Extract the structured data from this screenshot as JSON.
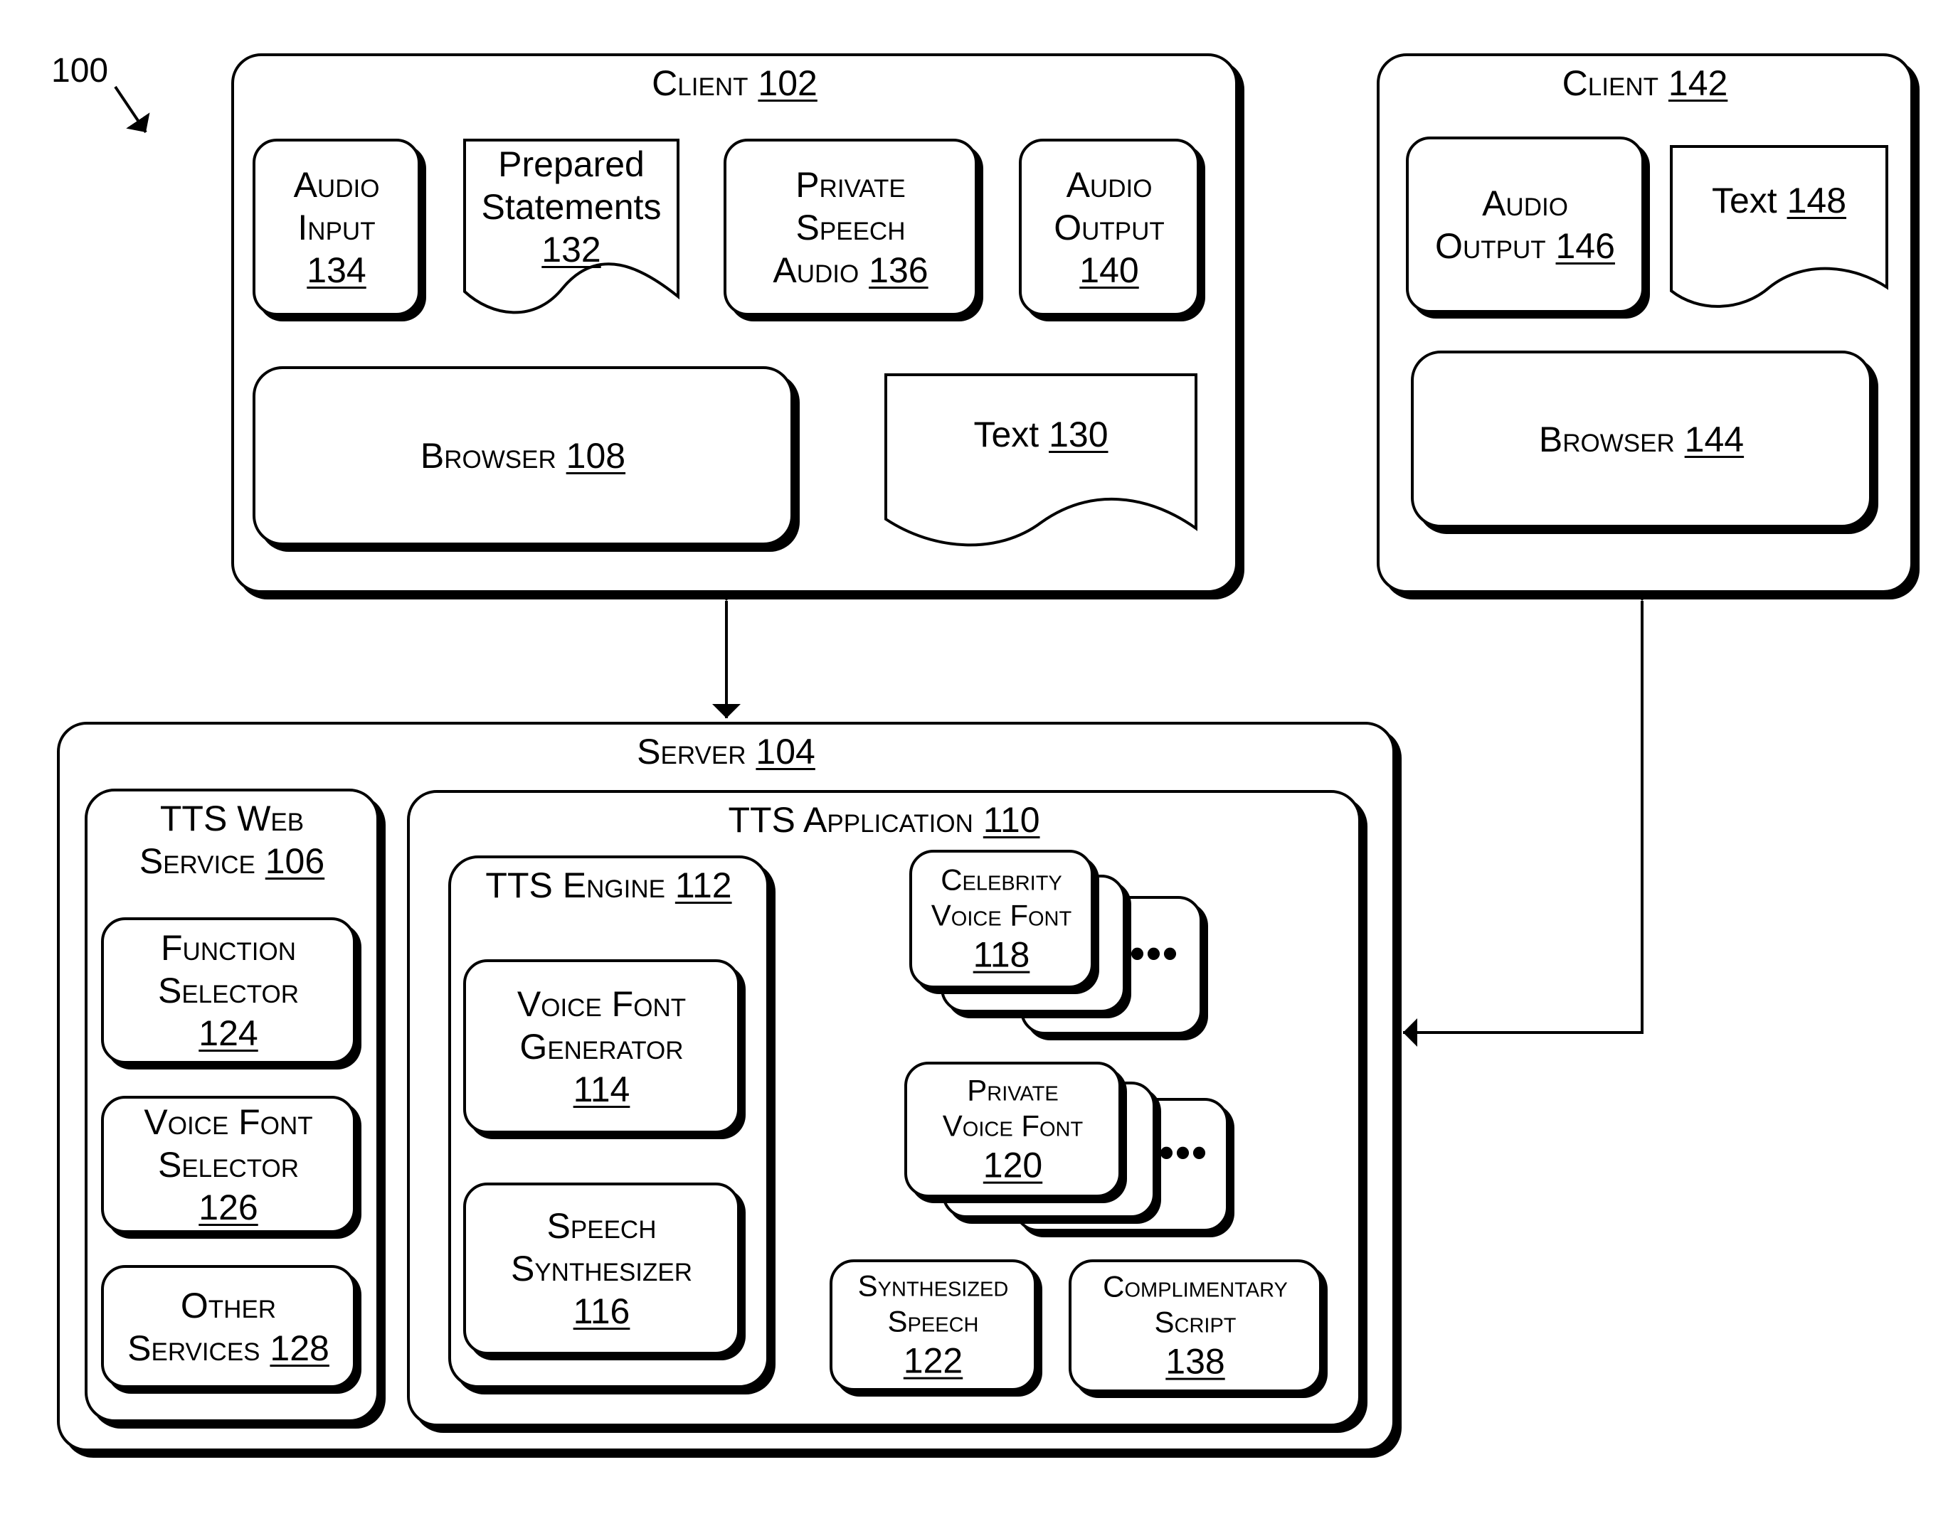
{
  "figure_ref": "100",
  "client_102": {
    "title": "Client",
    "num": "102",
    "audio_input": {
      "l1": "Audio",
      "l2": "Input",
      "num": "134"
    },
    "prepared_statements": {
      "l1": "Prepared",
      "l2": "Statements",
      "num": "132"
    },
    "private_speech_audio": {
      "l1": "Private",
      "l2": "Speech",
      "l3": "Audio",
      "num": "136"
    },
    "audio_output": {
      "l1": "Audio",
      "l2": "Output",
      "num": "140"
    },
    "browser": {
      "label": "Browser",
      "num": "108"
    },
    "text": {
      "label": "Text",
      "num": "130"
    }
  },
  "client_142": {
    "title": "Client",
    "num": "142",
    "audio_output": {
      "l1": "Audio",
      "l2": "Output",
      "num": "146"
    },
    "text": {
      "label": "Text",
      "num": "148"
    },
    "browser": {
      "label": "Browser",
      "num": "144"
    }
  },
  "server_104": {
    "title": "Server",
    "num": "104",
    "tts_web_service": {
      "l1": "TTS Web",
      "l2": "Service",
      "num": "106",
      "function_selector": {
        "l1": "Function",
        "l2": "Selector",
        "num": "124"
      },
      "voice_font_selector": {
        "l1": "Voice Font",
        "l2": "Selector",
        "num": "126"
      },
      "other_services": {
        "l1": "Other",
        "l2": "Services",
        "num": "128"
      }
    },
    "tts_application": {
      "title": "TTS Application",
      "num": "110",
      "tts_engine": {
        "title": "TTS Engine",
        "num": "112",
        "voice_font_generator": {
          "l1": "Voice Font",
          "l2": "Generator",
          "num": "114"
        },
        "speech_synthesizer": {
          "l1": "Speech",
          "l2": "Synthesizer",
          "num": "116"
        }
      },
      "celebrity_voice_font": {
        "l1": "Celebrity",
        "l2": "Voice Font",
        "num": "118",
        "more": "•••"
      },
      "private_voice_font": {
        "l1": "Private",
        "l2": "Voice Font",
        "num": "120",
        "more": "•••"
      },
      "synthesized_speech": {
        "l1": "Synthesized",
        "l2": "Speech",
        "num": "122"
      },
      "complimentary_script": {
        "l1": "Complimentary",
        "l2": "Script",
        "num": "138"
      }
    }
  }
}
